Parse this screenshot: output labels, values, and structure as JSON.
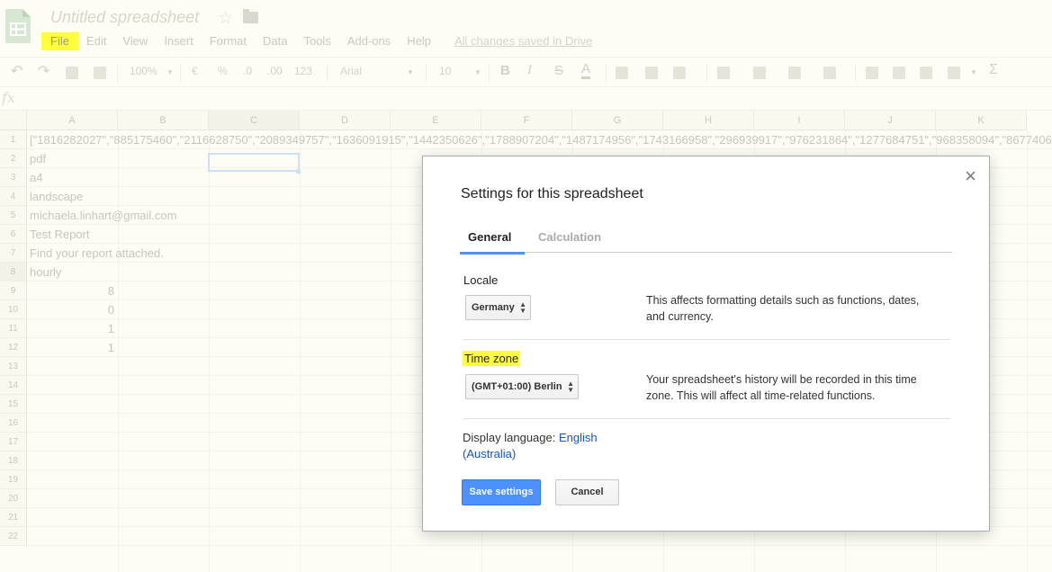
{
  "app": {
    "title": "Untitled spreadsheet",
    "icons": [
      "sheets-logo-icon",
      "star-icon",
      "folder-icon"
    ],
    "menu": [
      "File",
      "Edit",
      "View",
      "Insert",
      "Format",
      "Data",
      "Tools",
      "Add-ons",
      "Help"
    ],
    "saved_status": "All changes saved in Drive",
    "highlight_color": "#ffff3a"
  },
  "toolbar": {
    "zoom": "100%",
    "currency": "€",
    "percent": "%",
    "dec_less": ".0",
    "dec_more": ".00",
    "more_formats": "123",
    "font": "Arial",
    "font_size": "10",
    "bold": "B",
    "italic": "I",
    "strike": "S",
    "text_color": "A",
    "sum": "Σ"
  },
  "formula_bar": {
    "fx": "fx"
  },
  "grid": {
    "columns": [
      "A",
      "B",
      "C",
      "D",
      "E",
      "F",
      "G",
      "H",
      "I",
      "J",
      "K"
    ],
    "rows": [
      "1",
      "2",
      "3",
      "4",
      "5",
      "6",
      "7",
      "8",
      "9",
      "10",
      "11",
      "12",
      "13",
      "14",
      "15",
      "16",
      "17",
      "18",
      "19",
      "20",
      "21",
      "22"
    ],
    "cells": {
      "r1": "[\"1816282027\",\"885175460\",\"2116628750\",\"2089349757\",\"1636091915\",\"1442350626\",\"1788907204\",\"1487174956\",\"1743166958\",\"296939917\",\"976231864\",\"1277684751\",\"968358094\",\"8677406",
      "r2": "pdf",
      "r3": "a4",
      "r4": "landscape",
      "r5": "michaela.linhart@gmail.com",
      "r6": "Test Report",
      "r7": "Find your report attached.",
      "r8": "hourly",
      "r9": "8",
      "r10": "0",
      "r11": "1",
      "r12": "1"
    }
  },
  "dialog": {
    "title": "Settings for this spreadsheet",
    "close_glyph": "×",
    "tabs": [
      "General",
      "Calculation"
    ],
    "locale_label": "Locale",
    "locale_value": "Germany",
    "locale_desc_1": "This affects formatting details such as functions, dates,",
    "locale_desc_2": "and currency.",
    "timezone_label": "Time zone",
    "timezone_value": "(GMT+01:00) Berlin",
    "timezone_desc_1": "Your spreadsheet's history will be recorded in this time",
    "timezone_desc_2": "zone. This will affect all time-related functions.",
    "display_language_label": "Display language:",
    "display_language_value_1": "English",
    "display_language_value_2": "(Australia)",
    "save_label": "Save settings",
    "cancel_label": "Cancel",
    "accent_color": "#4d90fe",
    "link_color": "#1155cc"
  }
}
